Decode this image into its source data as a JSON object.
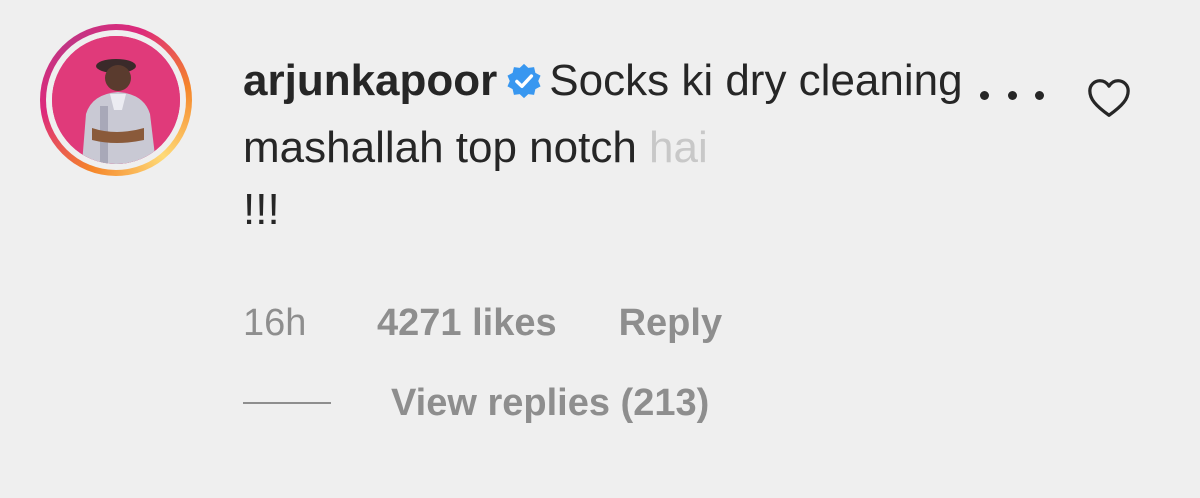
{
  "comment": {
    "username": "arjunkapoor",
    "verified": true,
    "text_main": "Socks ki dry cleaning mashallah top notch ",
    "text_faded": "hai",
    "text_end": "!!!",
    "time": "16h",
    "likes": "4271 likes",
    "reply_label": "Reply",
    "view_replies_label": "View replies (213)",
    "liked": false
  },
  "icons": {
    "verified": "verified-badge-icon",
    "more": "more-options-icon",
    "like": "heart-icon"
  },
  "colors": {
    "background": "#efefef",
    "text": "#262626",
    "secondary_text": "#8e8e8e",
    "verified_blue": "#3897f0",
    "avatar_bg": "#e03a7a"
  }
}
